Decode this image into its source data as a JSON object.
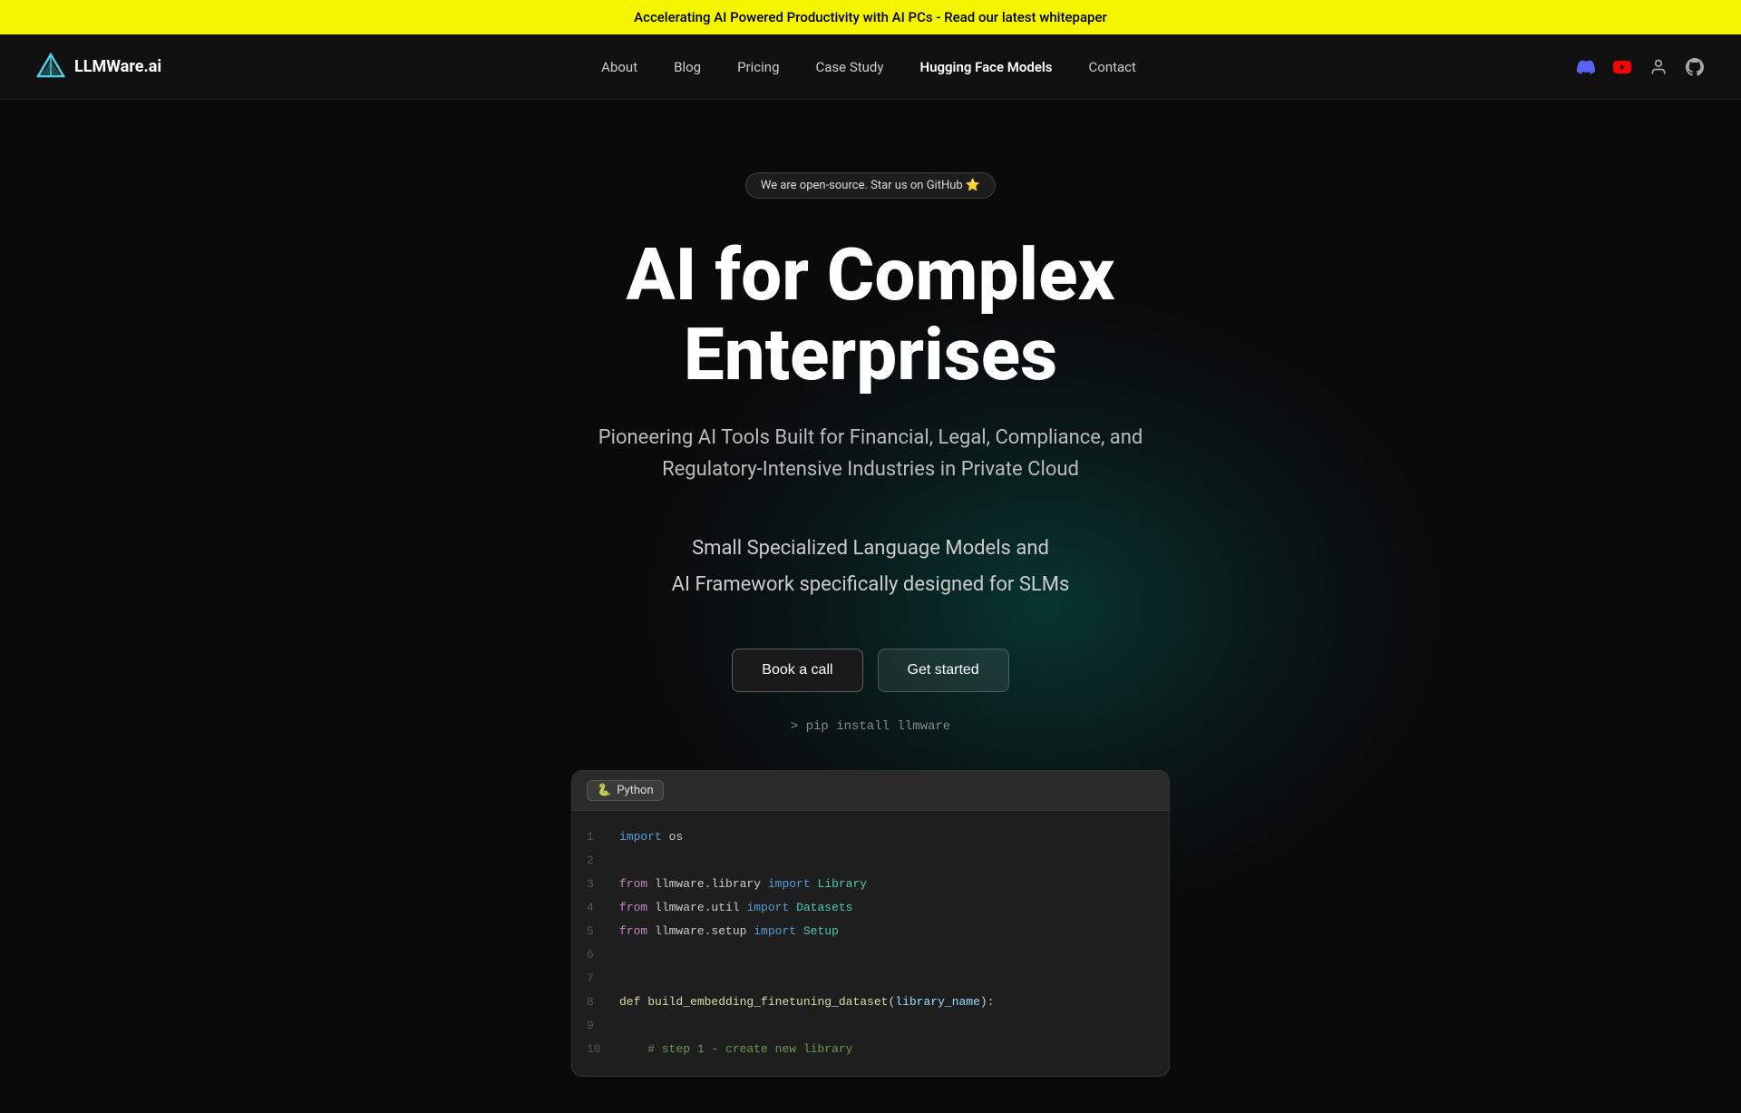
{
  "banner": {
    "text": "Accelerating AI Powered Productivity with AI PCs - Read our latest whitepaper"
  },
  "navbar": {
    "logo_text": "LLMWare.ai",
    "nav_items": [
      {
        "label": "About",
        "active": false
      },
      {
        "label": "Blog",
        "active": false
      },
      {
        "label": "Pricing",
        "active": false
      },
      {
        "label": "Case Study",
        "active": false
      },
      {
        "label": "Hugging Face Models",
        "active": false
      },
      {
        "label": "Contact",
        "active": false
      }
    ],
    "social_icons": [
      "discord",
      "youtube",
      "account",
      "github"
    ]
  },
  "hero": {
    "badge_text": "We are open-source. Star us on GitHub ⭐",
    "title": "AI for Complex Enterprises",
    "subtitle": "Pioneering AI Tools Built for Financial, Legal, Compliance, and Regulatory-Intensive Industries in Private Cloud",
    "secondary_line1": "Small Specialized Language Models and",
    "secondary_line2": "AI Framework specifically designed for SLMs",
    "btn_book": "Book a call",
    "btn_started": "Get started",
    "pip_command": "> pip install llmware",
    "code_lang": "Python",
    "code_lines": [
      {
        "num": "1",
        "content": "import os"
      },
      {
        "num": "2",
        "content": ""
      },
      {
        "num": "3",
        "content": "from llmware.library import Library"
      },
      {
        "num": "4",
        "content": "from llmware.util import Datasets"
      },
      {
        "num": "5",
        "content": "from llmware.setup import Setup"
      },
      {
        "num": "6",
        "content": ""
      },
      {
        "num": "7",
        "content": ""
      },
      {
        "num": "8",
        "content": "def build_embedding_finetuning_dataset(library_name):"
      },
      {
        "num": "9",
        "content": ""
      },
      {
        "num": "10",
        "content": "    # step 1 - create new library"
      }
    ]
  }
}
